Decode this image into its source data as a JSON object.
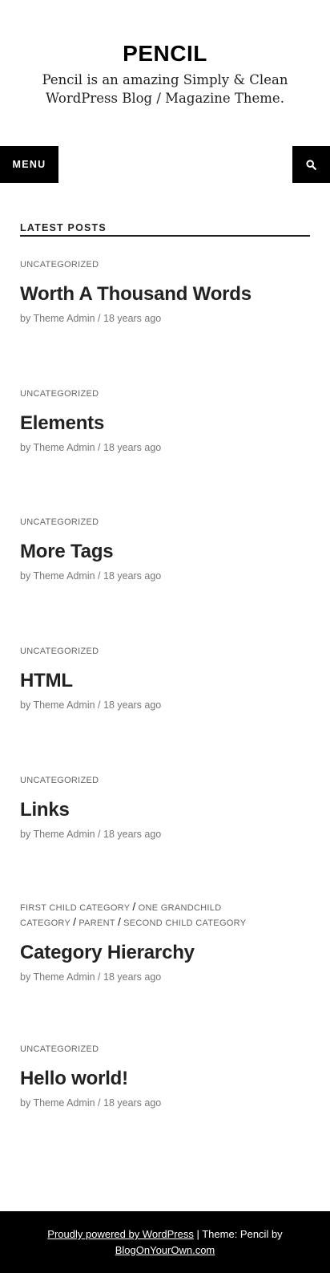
{
  "site": {
    "title": "PENCIL",
    "description": "Pencil is an amazing Simply & Clean WordPress Blog / Magazine Theme."
  },
  "nav": {
    "menu_label": "MENU",
    "search_icon": "search-icon"
  },
  "section": {
    "title": "LATEST POSTS"
  },
  "posts": [
    {
      "categories": "UNCATEGORIZED",
      "title": "Worth A Thousand Words",
      "meta": "by Theme Admin / 18 years ago"
    },
    {
      "categories": "UNCATEGORIZED",
      "title": "Elements",
      "meta": "by Theme Admin / 18 years ago"
    },
    {
      "categories": "UNCATEGORIZED",
      "title": "More Tags",
      "meta": "by Theme Admin / 18 years ago"
    },
    {
      "categories": "UNCATEGORIZED",
      "title": "HTML",
      "meta": "by Theme Admin / 18 years ago"
    },
    {
      "categories": "UNCATEGORIZED",
      "title": "Links",
      "meta": "by Theme Admin / 18 years ago"
    },
    {
      "categories_list": [
        "FIRST CHILD CATEGORY",
        "ONE GRANDCHILD CATEGORY",
        "PARENT",
        "SECOND CHILD CATEGORY"
      ],
      "title": "Category Hierarchy",
      "meta": "by Theme Admin / 18 years ago"
    },
    {
      "categories": "UNCATEGORIZED",
      "title": "Hello world!",
      "meta": "by Theme Admin / 18 years ago"
    }
  ],
  "footer": {
    "link1": "Proudly powered by WordPress",
    "middle": " | Theme: Pencil by ",
    "link2": "BlogOnYourOwn.com"
  }
}
